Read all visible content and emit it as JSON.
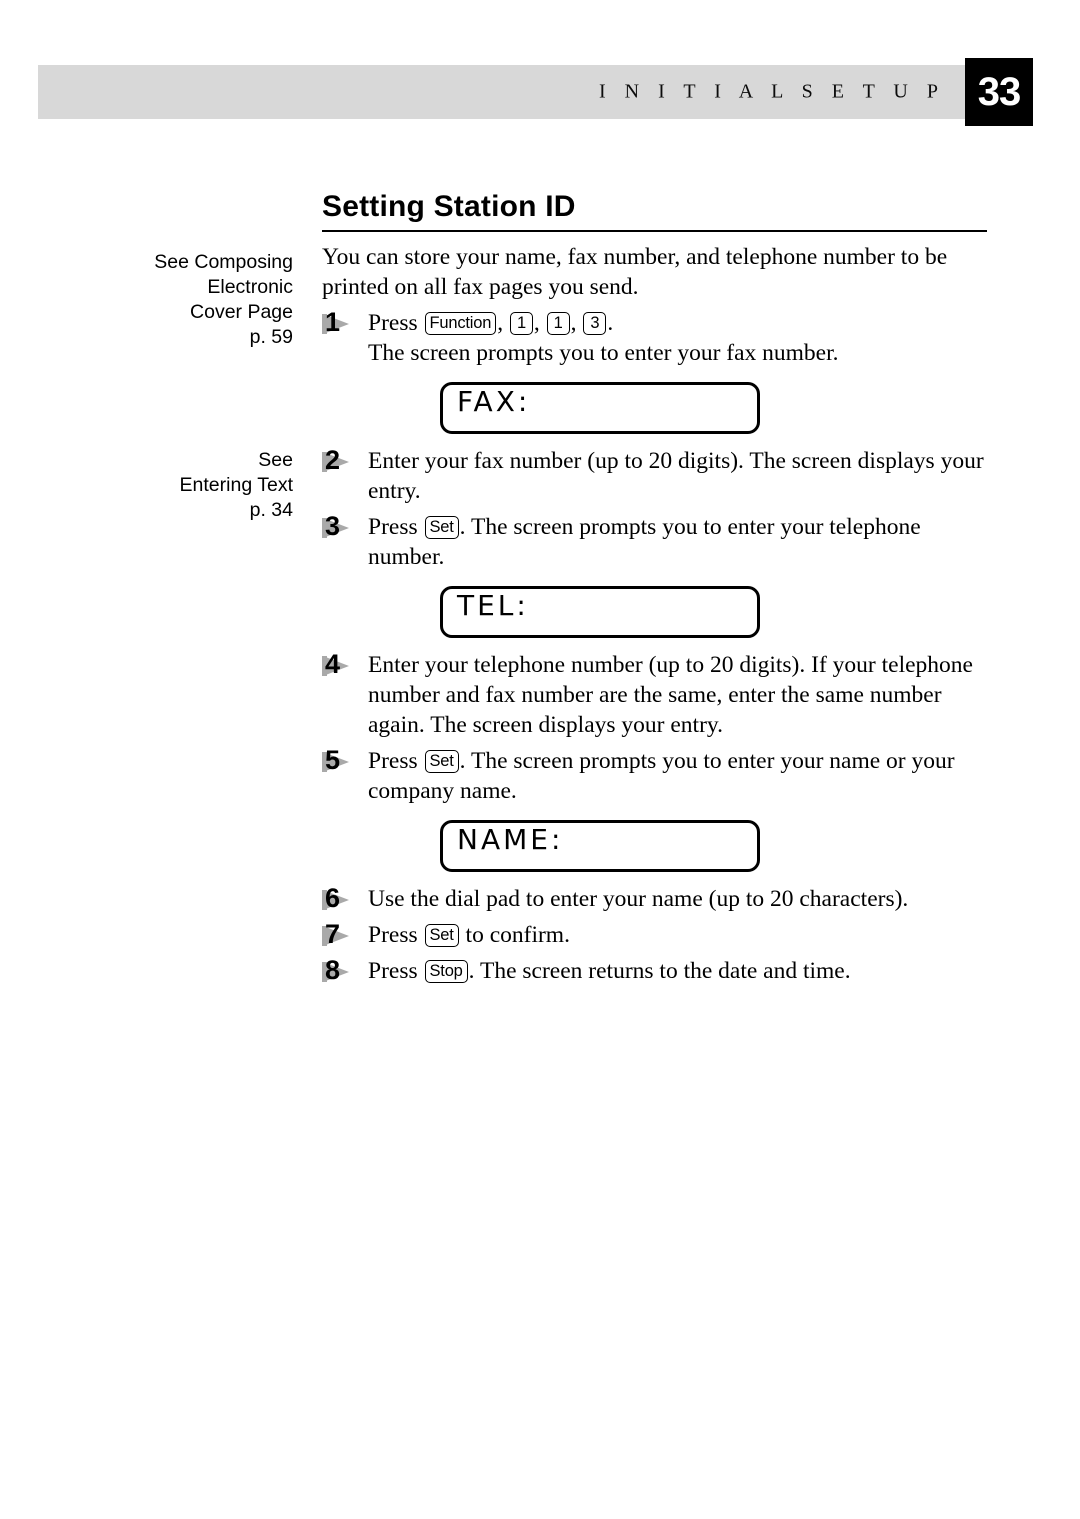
{
  "header": {
    "running_head": "I N I T I A L   S E T U P",
    "page_number": "33",
    "band_color": "#d8d8d8",
    "page_number_bg": "#000000",
    "page_number_color": "#ffffff"
  },
  "margin_notes": [
    {
      "lines": [
        "See Composing",
        "Electronic",
        "Cover Page",
        "p. 59"
      ]
    },
    {
      "lines": [
        "See",
        "Entering Text",
        "p. 34"
      ]
    }
  ],
  "section": {
    "title": "Setting Station ID",
    "intro": "You can store your name, fax number, and telephone number to be printed on all fax pages you send."
  },
  "steps": [
    {
      "number": "1",
      "parts": [
        {
          "type": "text",
          "value": "Press "
        },
        {
          "type": "key",
          "value": "Function"
        },
        {
          "type": "text",
          "value": ", "
        },
        {
          "type": "key",
          "value": "1"
        },
        {
          "type": "text",
          "value": ", "
        },
        {
          "type": "key",
          "value": "1"
        },
        {
          "type": "text",
          "value": ", "
        },
        {
          "type": "key",
          "value": "3"
        },
        {
          "type": "text",
          "value": "."
        }
      ],
      "continuation": "The screen prompts you to enter your fax number."
    },
    {
      "number": "2",
      "parts": [
        {
          "type": "text",
          "value": "Enter your fax number (up to 20 digits). The screen displays your entry."
        }
      ]
    },
    {
      "number": "3",
      "parts": [
        {
          "type": "text",
          "value": "Press "
        },
        {
          "type": "key",
          "value": "Set"
        },
        {
          "type": "text",
          "value": ". The screen prompts you to enter your telephone number."
        }
      ]
    },
    {
      "number": "4",
      "parts": [
        {
          "type": "text",
          "value": "Enter your telephone number (up to 20 digits). If your telephone number and fax number are the same, enter the same number again. The screen displays your entry."
        }
      ]
    },
    {
      "number": "5",
      "parts": [
        {
          "type": "text",
          "value": "Press "
        },
        {
          "type": "key",
          "value": "Set"
        },
        {
          "type": "text",
          "value": ". The screen prompts you to enter your name or your company name."
        }
      ]
    },
    {
      "number": "6",
      "parts": [
        {
          "type": "text",
          "value": "Use the dial pad to enter your name (up to 20 characters)."
        }
      ]
    },
    {
      "number": "7",
      "parts": [
        {
          "type": "text",
          "value": "Press "
        },
        {
          "type": "key",
          "value": "Set"
        },
        {
          "type": "text",
          "value": " to confirm."
        }
      ]
    },
    {
      "number": "8",
      "parts": [
        {
          "type": "text",
          "value": "Press "
        },
        {
          "type": "key",
          "value": "Stop"
        },
        {
          "type": "text",
          "value": ". The screen returns to the date and time."
        }
      ]
    }
  ],
  "lcd_displays": {
    "fax": "FAX:",
    "tel": "TEL:",
    "name": "NAME:"
  },
  "step_texts": {
    "s1_press": "Press ",
    "s1_comma": ", ",
    "s1_period": ".",
    "s1_cont": "The screen prompts you to enter your fax number.",
    "s2": "Enter your fax number (up to 20 digits). The screen displays your entry.",
    "s3_press": "Press ",
    "s3_rest": ". The screen prompts you to enter your telephone number.",
    "s4": "Enter your telephone number (up to 20 digits). If your telephone number and fax number are the same, enter the same number again. The screen displays your entry.",
    "s5_press": "Press ",
    "s5_rest": ". The screen prompts you to enter your name or your company name.",
    "s6": "Use the dial pad to enter your name (up to 20 characters).",
    "s7_press": "Press ",
    "s7_rest": " to confirm.",
    "s8_press": "Press ",
    "s8_rest": ". The screen returns to the date and time."
  },
  "keys": {
    "function": "Function",
    "one_a": "1",
    "one_b": "1",
    "three": "3",
    "set_a": "Set",
    "set_b": "Set",
    "set_c": "Set",
    "stop": "Stop"
  },
  "step_numbers": {
    "n1": "1",
    "n2": "2",
    "n3": "3",
    "n4": "4",
    "n5": "5",
    "n6": "6",
    "n7": "7",
    "n8": "8"
  }
}
